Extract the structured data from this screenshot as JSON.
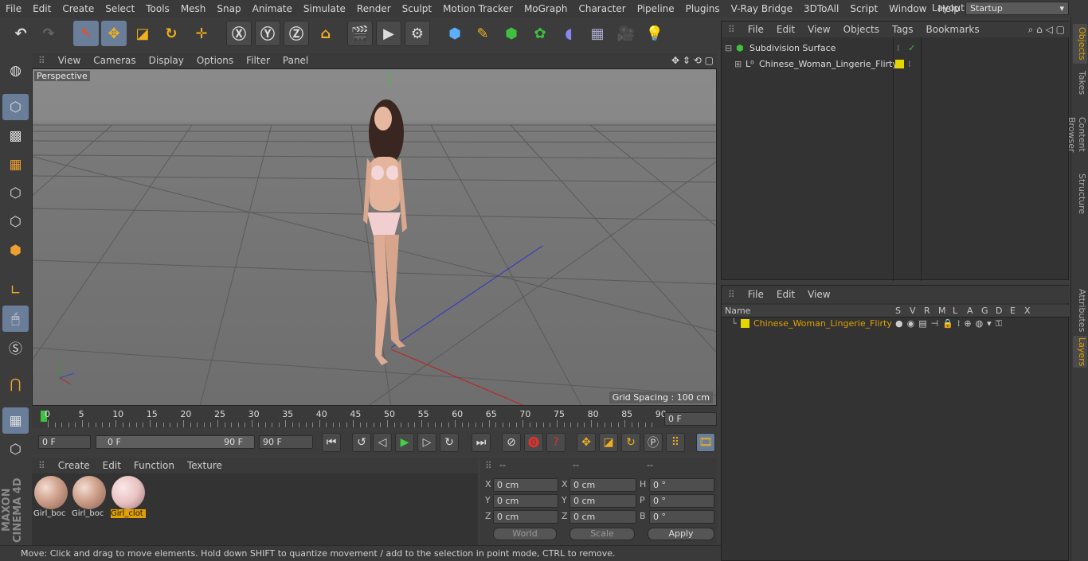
{
  "menubar": {
    "items": [
      "File",
      "Edit",
      "Create",
      "Select",
      "Tools",
      "Mesh",
      "Snap",
      "Animate",
      "Simulate",
      "Render",
      "Sculpt",
      "Motion Tracker",
      "MoGraph",
      "Character",
      "Pipeline",
      "Plugins",
      "V-Ray Bridge",
      "3DToAll",
      "Script",
      "Window",
      "Help"
    ],
    "layout_label": "Layout:",
    "layout_value": "Startup"
  },
  "viewport": {
    "menu": [
      "View",
      "Cameras",
      "Display",
      "Options",
      "Filter",
      "Panel"
    ],
    "label": "Perspective",
    "grid_spacing": "Grid Spacing : 100 cm"
  },
  "timeline": {
    "ticks": [
      "0",
      "5",
      "10",
      "15",
      "20",
      "25",
      "30",
      "35",
      "40",
      "45",
      "50",
      "55",
      "60",
      "65",
      "70",
      "75",
      "80",
      "85",
      "90"
    ],
    "current_frame": "0 F"
  },
  "playbar": {
    "start": "0 F",
    "range_start": "0 F",
    "range_end": "90 F",
    "end": "90 F"
  },
  "material_manager": {
    "menu": [
      "Create",
      "Edit",
      "Function",
      "Texture"
    ],
    "materials": [
      {
        "name": "Girl_boc",
        "selected": false
      },
      {
        "name": "Girl_boc",
        "selected": false
      },
      {
        "name": "Girl_clot",
        "selected": true
      }
    ]
  },
  "coordinates": {
    "headers": [
      "--",
      "--",
      "--"
    ],
    "rows": [
      {
        "a_label": "X",
        "a_val": "0 cm",
        "b_label": "X",
        "b_val": "0 cm",
        "c_label": "H",
        "c_val": "0 °"
      },
      {
        "a_label": "Y",
        "a_val": "0 cm",
        "b_label": "Y",
        "b_val": "0 cm",
        "c_label": "P",
        "c_val": "0 °"
      },
      {
        "a_label": "Z",
        "a_val": "0 cm",
        "b_label": "Z",
        "b_val": "0 cm",
        "c_label": "B",
        "c_val": "0 °"
      }
    ],
    "world_select": "World",
    "scale_select": "Scale",
    "apply": "Apply"
  },
  "status": "Move: Click and drag to move elements. Hold down SHIFT to quantize movement / add to the selection in point mode, CTRL to remove.",
  "objects": {
    "menu": [
      "File",
      "Edit",
      "View",
      "Objects",
      "Tags",
      "Bookmarks"
    ],
    "items": [
      "Subdivision Surface",
      "Chinese_Woman_Lingerie_Flirty"
    ]
  },
  "layers": {
    "menu": [
      "File",
      "Edit",
      "View"
    ],
    "headers": [
      "Name",
      "S",
      "V",
      "R",
      "M",
      "L",
      "A",
      "G",
      "D",
      "E",
      "X"
    ],
    "items": [
      "Chinese_Woman_Lingerie_Flirty"
    ]
  },
  "right_tabs": [
    "Objects",
    "Takes",
    "Content Browser",
    "Structure",
    "Attributes",
    "Layers"
  ],
  "colors": {
    "accent": "#e0a000",
    "selection": "#6a7e99",
    "layer_color": "#e6d600"
  }
}
